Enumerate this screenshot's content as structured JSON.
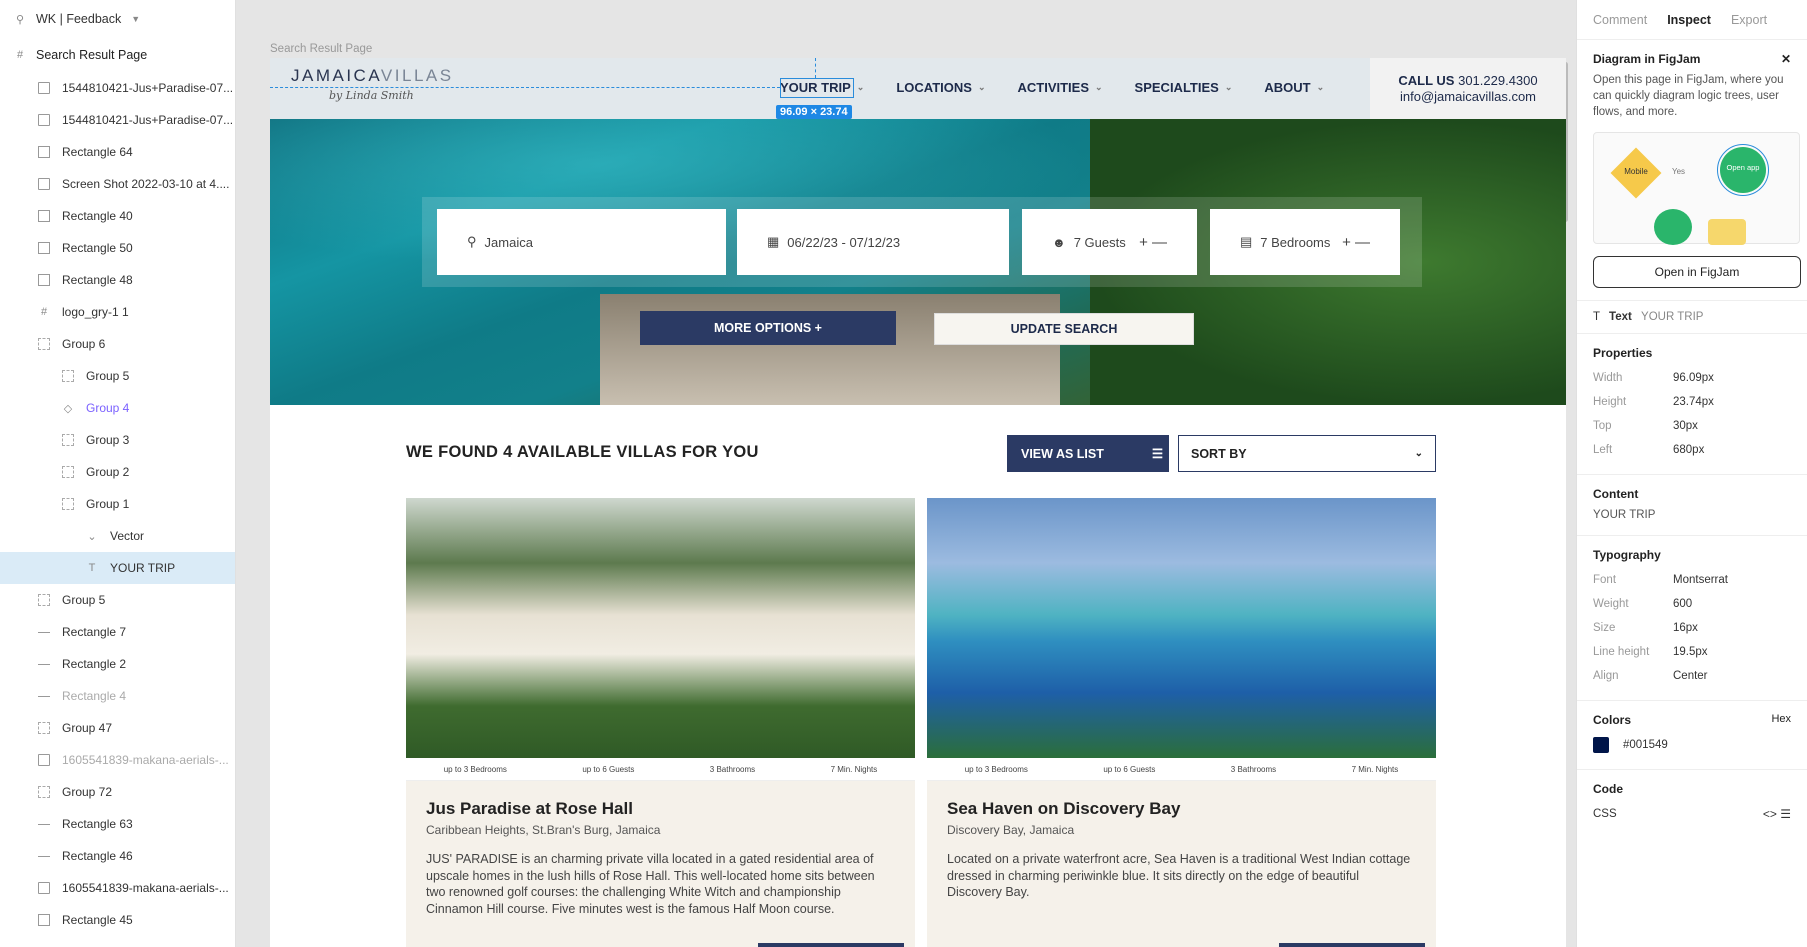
{
  "layers_panel": {
    "file_title": "WK | Feedback",
    "page_name": "Search Result Page",
    "items": [
      {
        "label": "1544810421-Jus+Paradise-07...",
        "type": "image",
        "indent": 1,
        "state": ""
      },
      {
        "label": "1544810421-Jus+Paradise-07...",
        "type": "image",
        "indent": 1,
        "state": ""
      },
      {
        "label": "Rectangle 64",
        "type": "rect",
        "indent": 1,
        "state": ""
      },
      {
        "label": "Screen Shot 2022-03-10 at 4....",
        "type": "image",
        "indent": 1,
        "state": ""
      },
      {
        "label": "Rectangle 40",
        "type": "rect",
        "indent": 1,
        "state": ""
      },
      {
        "label": "Rectangle 50",
        "type": "rect",
        "indent": 1,
        "state": ""
      },
      {
        "label": "Rectangle 48",
        "type": "rect",
        "indent": 1,
        "state": ""
      },
      {
        "label": "logo_gry-1 1",
        "type": "frame",
        "indent": 1,
        "state": ""
      },
      {
        "label": "Group 6",
        "type": "group",
        "indent": 1,
        "state": ""
      },
      {
        "label": "Group 5",
        "type": "group",
        "indent": 2,
        "state": ""
      },
      {
        "label": "Group 4",
        "type": "component",
        "indent": 2,
        "state": "purple"
      },
      {
        "label": "Group 3",
        "type": "group",
        "indent": 2,
        "state": ""
      },
      {
        "label": "Group 2",
        "type": "group",
        "indent": 2,
        "state": ""
      },
      {
        "label": "Group 1",
        "type": "group",
        "indent": 2,
        "state": ""
      },
      {
        "label": "Vector",
        "type": "vector",
        "indent": 3,
        "state": ""
      },
      {
        "label": "YOUR TRIP",
        "type": "text",
        "indent": 3,
        "state": "sel"
      },
      {
        "label": "Group 5",
        "type": "group",
        "indent": 1,
        "state": ""
      },
      {
        "label": "Rectangle 7",
        "type": "line",
        "indent": 1,
        "state": ""
      },
      {
        "label": "Rectangle 2",
        "type": "line",
        "indent": 1,
        "state": ""
      },
      {
        "label": "Rectangle 4",
        "type": "line",
        "indent": 1,
        "state": "dim"
      },
      {
        "label": "Group 47",
        "type": "group",
        "indent": 1,
        "state": ""
      },
      {
        "label": "1605541839-makana-aerials-...",
        "type": "image",
        "indent": 1,
        "state": "dim"
      },
      {
        "label": "Group 72",
        "type": "group",
        "indent": 1,
        "state": ""
      },
      {
        "label": "Rectangle 63",
        "type": "line",
        "indent": 1,
        "state": ""
      },
      {
        "label": "Rectangle 46",
        "type": "line",
        "indent": 1,
        "state": ""
      },
      {
        "label": "1605541839-makana-aerials-...",
        "type": "image",
        "indent": 1,
        "state": ""
      },
      {
        "label": "Rectangle 45",
        "type": "rect",
        "indent": 1,
        "state": ""
      }
    ]
  },
  "canvas": {
    "frame_label": "Search Result Page"
  },
  "site": {
    "logo_main": "JAMAICA",
    "logo_accent": "VILLAS",
    "logo_sub": "by Linda Smith",
    "menu": [
      "YOUR TRIP",
      "LOCATIONS",
      "ACTIVITIES",
      "SPECIALTIES",
      "ABOUT"
    ],
    "selection_dims": "96.09 × 23.74",
    "call_label": "CALL US",
    "call_phone": "301.229.4300",
    "email": "info@jamaicavillas.com",
    "search": {
      "location": "Jamaica",
      "dates": "06/22/23 - 07/12/23",
      "guests": "7 Guests",
      "bedrooms": "7 Bedrooms",
      "stepper": "+ —"
    },
    "more_options": "MORE OPTIONS  +",
    "update_search": "UPDATE SEARCH",
    "found": "WE FOUND 4 AVAILABLE VILLAS FOR YOU",
    "view_as_list": "VIEW AS LIST",
    "sort_by": "SORT BY",
    "cards": [
      {
        "stats": [
          "up to 3 Bedrooms",
          "up to 6 Guests",
          "3 Bathrooms",
          "7 Min. Nights"
        ],
        "name": "Jus Paradise at Rose Hall",
        "location": "Caribbean Heights, St.Bran's Burg, Jamaica",
        "description": "JUS' PARADISE is an charming private villa located in a gated residential area of upscale homes in the lush hills of Rose Hall. This well-located home sits between two renowned golf courses: the challenging White Witch and championship Cinnamon Hill course. Five minutes west is the famous Half Moon course."
      },
      {
        "stats": [
          "up to 3 Bedrooms",
          "up to 6 Guests",
          "3 Bathrooms",
          "7 Min. Nights"
        ],
        "name": "Sea Haven on Discovery Bay",
        "location": "Discovery Bay, Jamaica",
        "description": "Located on a private waterfront acre, Sea Haven is a traditional West Indian cottage dressed in charming periwinkle blue. It sits directly on the edge of beautiful Discovery Bay."
      }
    ]
  },
  "inspect": {
    "tabs": [
      "Comment",
      "Inspect",
      "Export"
    ],
    "diagram_title": "Diagram in FigJam",
    "diagram_desc": "Open this page in FigJam, where you can quickly diagram logic trees, user flows, and more.",
    "figjam_mobile": "Mobile",
    "figjam_yes": "Yes",
    "figjam_open": "Open app",
    "open_btn": "Open in FigJam",
    "text_label": "Text",
    "text_value": "YOUR TRIP",
    "properties_title": "Properties",
    "properties": [
      {
        "k": "Width",
        "v": "96.09px"
      },
      {
        "k": "Height",
        "v": "23.74px"
      },
      {
        "k": "Top",
        "v": "30px"
      },
      {
        "k": "Left",
        "v": "680px"
      }
    ],
    "content_title": "Content",
    "content_value": "YOUR TRIP",
    "typography_title": "Typography",
    "typography": [
      {
        "k": "Font",
        "v": "Montserrat"
      },
      {
        "k": "Weight",
        "v": "600"
      },
      {
        "k": "Size",
        "v": "16px"
      },
      {
        "k": "Line height",
        "v": "19.5px"
      },
      {
        "k": "Align",
        "v": "Center"
      }
    ],
    "colors_title": "Colors",
    "colors_mode": "Hex",
    "color_hex": "#001549",
    "code_title": "Code",
    "code_lang": "CSS"
  }
}
